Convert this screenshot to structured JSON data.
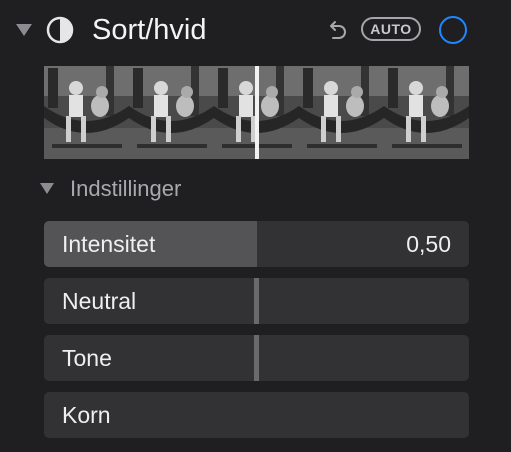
{
  "section": {
    "title": "Sort/hvid",
    "auto_label": "AUTO",
    "enabled": true,
    "expanded": true,
    "toggle_color": "#1e88ff",
    "icons": {
      "disclosure": "disclosure-triangle-icon",
      "effect": "black-white-half-circle-icon",
      "undo": "undo-arrow-icon"
    }
  },
  "thumbnails": {
    "count": 5,
    "selected_position": 0.5
  },
  "settings": {
    "title": "Indstillinger",
    "expanded": true,
    "sliders": [
      {
        "label": "Intensitet",
        "value": "0,50",
        "level": 0.5
      },
      {
        "label": "Neutral",
        "value": "",
        "level": 0.5
      },
      {
        "label": "Tone",
        "value": "",
        "level": 0.5
      },
      {
        "label": "Korn",
        "value": "",
        "level": 0
      }
    ]
  }
}
